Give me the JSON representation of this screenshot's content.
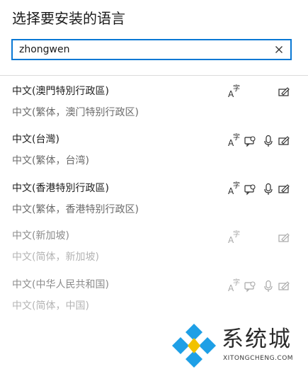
{
  "dialog": {
    "title": "选择要安装的语言"
  },
  "search": {
    "value": "zhongwen"
  },
  "languages": [
    {
      "name": "中文(澳門特別行政區)",
      "desc": "中文(繁体，澳门特别行政区)",
      "features": [
        "font-icon",
        "handwriting-icon"
      ]
    },
    {
      "name": "中文(台灣)",
      "desc": "中文(繁体，台湾)",
      "features": [
        "font-icon",
        "speech-icon",
        "mic-icon",
        "handwriting-icon"
      ]
    },
    {
      "name": "中文(香港特別行政區)",
      "desc": "中文(繁体，香港特别行政区)",
      "features": [
        "font-icon",
        "speech-icon",
        "mic-icon",
        "handwriting-icon"
      ]
    },
    {
      "name": "中文(新加坡)",
      "desc": "中文(简体，新加坡)",
      "features": [
        "font-icon",
        "handwriting-icon"
      ]
    },
    {
      "name": "中文(中华人民共和国)",
      "desc": "中文(简体，中国)",
      "features": [
        "font-icon",
        "speech-icon",
        "mic-icon",
        "handwriting-icon"
      ]
    }
  ],
  "font_icon": {
    "big": "A",
    "small": "字"
  },
  "watermark": {
    "text": "系统城",
    "url": "XITONGCHENG.COM"
  },
  "colors": {
    "accent": "#0a78d4",
    "logo_blue": "#1e9fe6"
  }
}
